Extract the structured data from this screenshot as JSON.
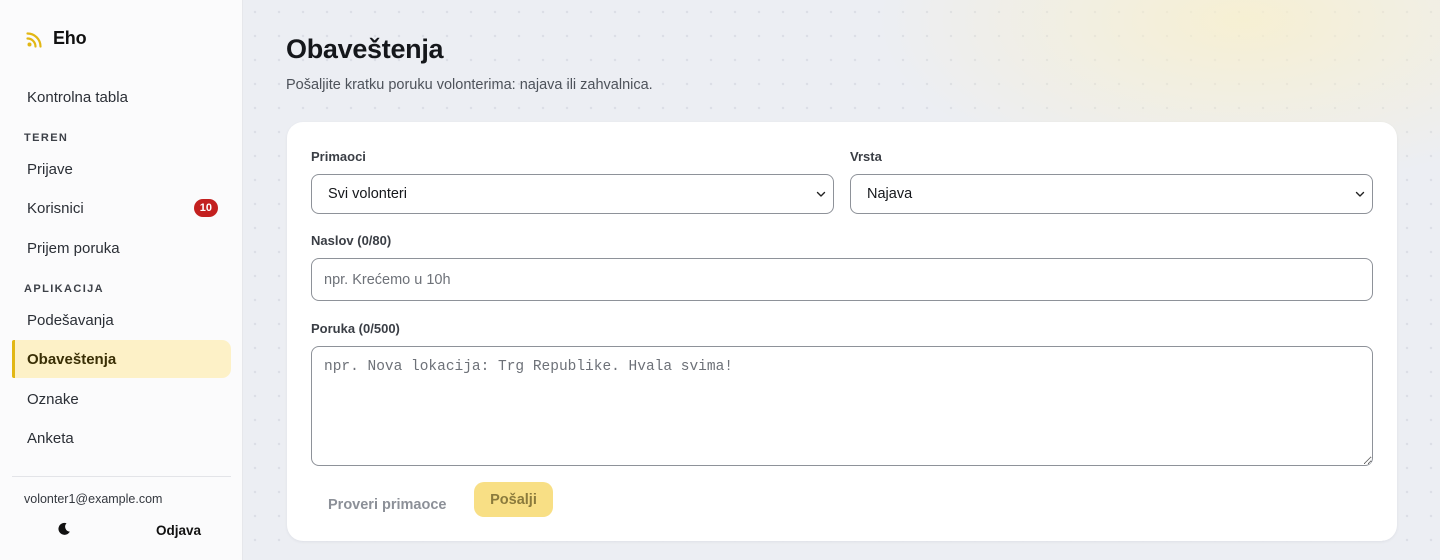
{
  "app": {
    "name": "Eho",
    "icon": "rss-icon",
    "accent": "#e2b714"
  },
  "sidebar": {
    "dashboard": "Kontrolna tabla",
    "section_field": "TEREN",
    "field_items": [
      {
        "label": "Prijave"
      },
      {
        "label": "Korisnici",
        "badge": "10"
      },
      {
        "label": "Prijem poruka"
      }
    ],
    "section_app": "APLIKACIJA",
    "app_items": [
      {
        "label": "Podešavanja"
      },
      {
        "label": "Obaveštenja",
        "active": true
      },
      {
        "label": "Oznake"
      },
      {
        "label": "Anketa"
      }
    ],
    "user_email": "volonter1@example.com",
    "theme_icon": "moon-icon",
    "logout": "Odjava"
  },
  "page": {
    "title": "Obaveštenja",
    "subtitle": "Pošaljite kratku poruku volonterima: najava ili zahvalnica."
  },
  "form": {
    "recipients": {
      "label": "Primaoci",
      "value": "Svi volonteri"
    },
    "type": {
      "label": "Vrsta",
      "value": "Najava"
    },
    "subject": {
      "label": "Naslov (0/80)",
      "placeholder": "npr. Krećemo u 10h",
      "value": ""
    },
    "message": {
      "label": "Poruka (0/500)",
      "placeholder": "npr. Nova lokacija: Trg Republike. Hvala svima!",
      "value": ""
    },
    "check_button": "Proveri primaoce",
    "send_button": "Pošalji"
  }
}
